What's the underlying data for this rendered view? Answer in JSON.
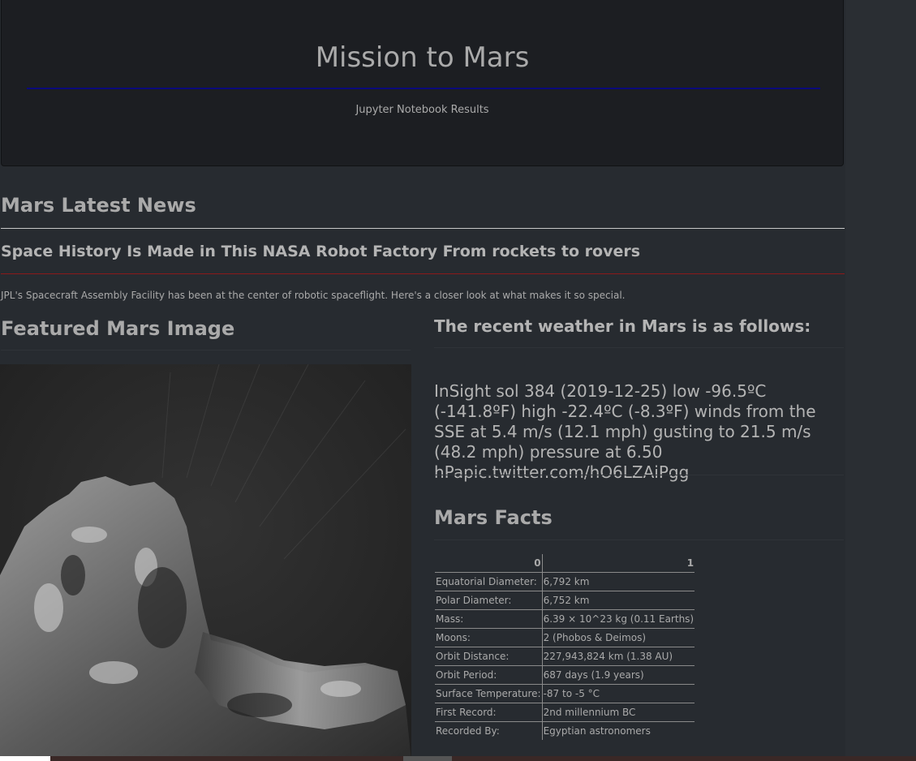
{
  "header": {
    "title": "Mission to Mars",
    "subtitle": "Jupyter Notebook Results"
  },
  "news": {
    "heading": "Mars Latest News",
    "title": "Space History Is Made in This NASA Robot Factory From rockets to rovers",
    "paragraph": "JPL's Spacecraft Assembly Facility has been at the center of robotic spaceflight. Here's a closer look at what makes it so special."
  },
  "featured": {
    "heading": "Featured Mars Image",
    "image_icon": "comet-photo"
  },
  "weather": {
    "heading": "The recent weather in Mars is as follows:",
    "text": "InSight sol 384 (2019-12-25) low -96.5ºC (-141.8ºF) high -22.4ºC (-8.3ºF) winds from the SSE at 5.4 m/s (12.1 mph) gusting to 21.5 m/s (48.2 mph) pressure at 6.50 hPapic.twitter.com/hO6LZAiPgg"
  },
  "facts": {
    "heading": "Mars Facts",
    "columns": [
      "0",
      "1"
    ],
    "rows": [
      [
        "Equatorial Diameter:",
        "6,792 km"
      ],
      [
        "Polar Diameter:",
        "6,752 km"
      ],
      [
        "Mass:",
        "6.39 × 10^23 kg (0.11 Earths)"
      ],
      [
        "Moons:",
        "2 (Phobos & Deimos)"
      ],
      [
        "Orbit Distance:",
        "227,943,824 km (1.38 AU)"
      ],
      [
        "Orbit Period:",
        "687 days (1.9 years)"
      ],
      [
        "Surface Temperature:",
        "-87 to -5 °C"
      ],
      [
        "First Record:",
        "2nd millennium BC"
      ],
      [
        "Recorded By:",
        "Egyptian astronomers"
      ]
    ]
  }
}
